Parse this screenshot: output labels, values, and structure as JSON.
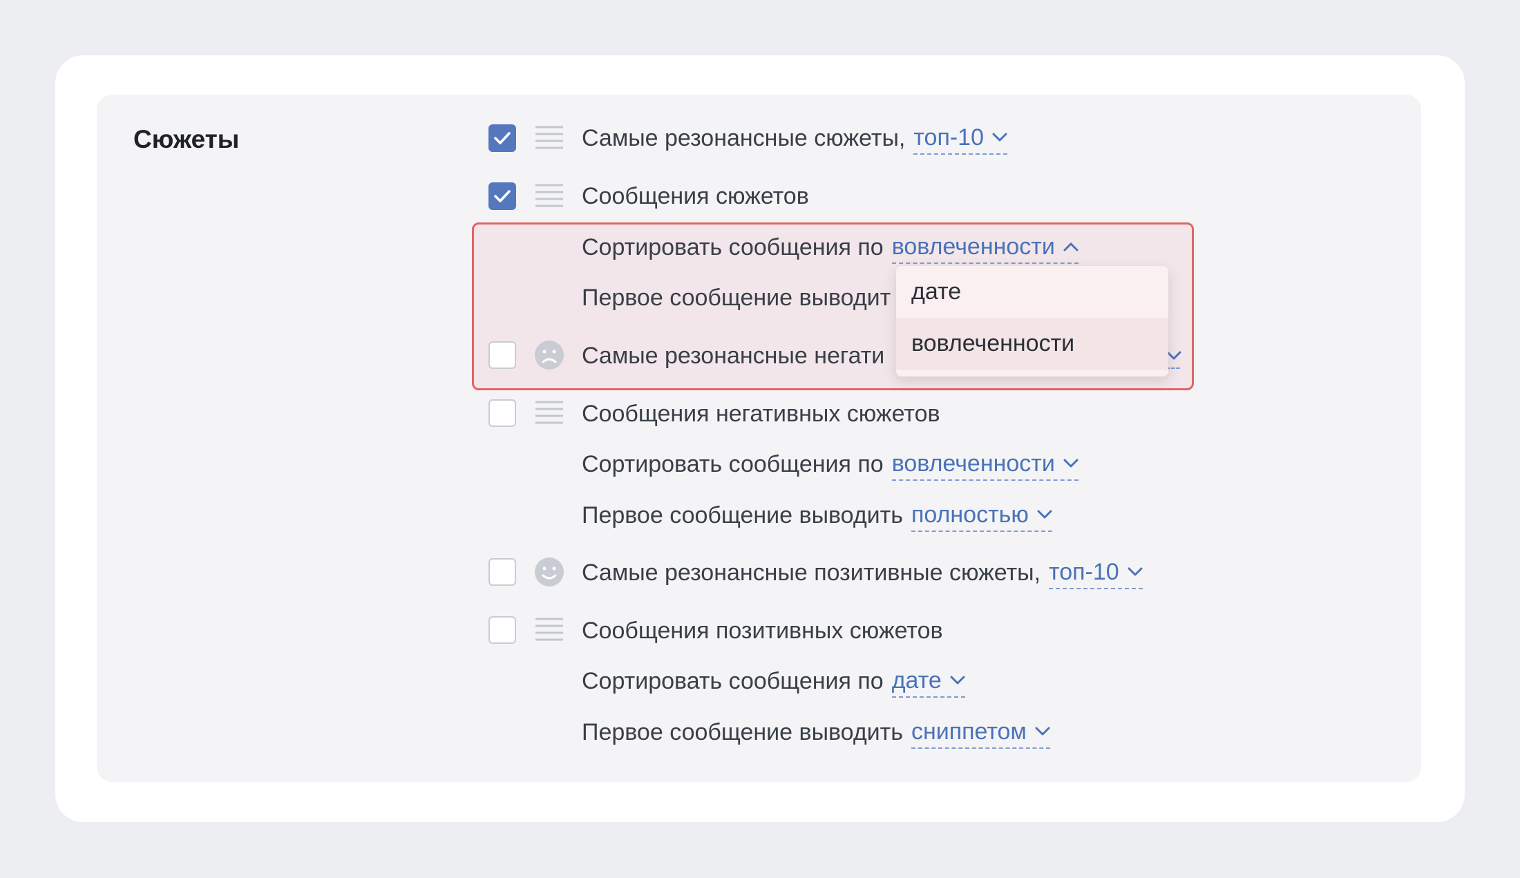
{
  "section": {
    "title": "Сюжеты"
  },
  "rows": {
    "r1": {
      "text": "Самые резонансные сюжеты,",
      "link": "топ-10",
      "checked": true
    },
    "r2": {
      "text": "Сообщения сюжетов",
      "checked": true
    },
    "r2_sort": {
      "text": "Сортировать сообщения по",
      "link": "вовлеченности"
    },
    "r2_first": {
      "text": "Первое сообщение выводит"
    },
    "r3": {
      "text": "Самые резонансные негати",
      "checked": false
    },
    "r4": {
      "text": "Сообщения негативных сюжетов",
      "checked": false
    },
    "r4_sort": {
      "text": "Сортировать сообщения по",
      "link": "вовлеченности"
    },
    "r4_first": {
      "text": "Первое сообщение выводить",
      "link": "полностью"
    },
    "r5": {
      "text": "Самые резонансные позитивные сюжеты,",
      "link": "топ-10",
      "checked": false
    },
    "r6": {
      "text": "Сообщения позитивных сюжетов",
      "checked": false
    },
    "r6_sort": {
      "text": "Сортировать сообщения по",
      "link": "дате"
    },
    "r6_first": {
      "text": "Первое сообщение выводить",
      "link": "сниппетом"
    }
  },
  "dropdown": {
    "options": [
      "дате",
      "вовлеченности"
    ],
    "selected": "вовлеченности"
  },
  "icons": {
    "list": "list-icon",
    "sad": "sad-face-icon",
    "happy": "happy-face-icon",
    "check": "check-icon",
    "chevron_down": "chevron-down-icon",
    "chevron_up": "chevron-up-icon"
  },
  "colors": {
    "accent": "#5577be",
    "link": "#4a72b8",
    "highlight_border": "#e06666"
  }
}
